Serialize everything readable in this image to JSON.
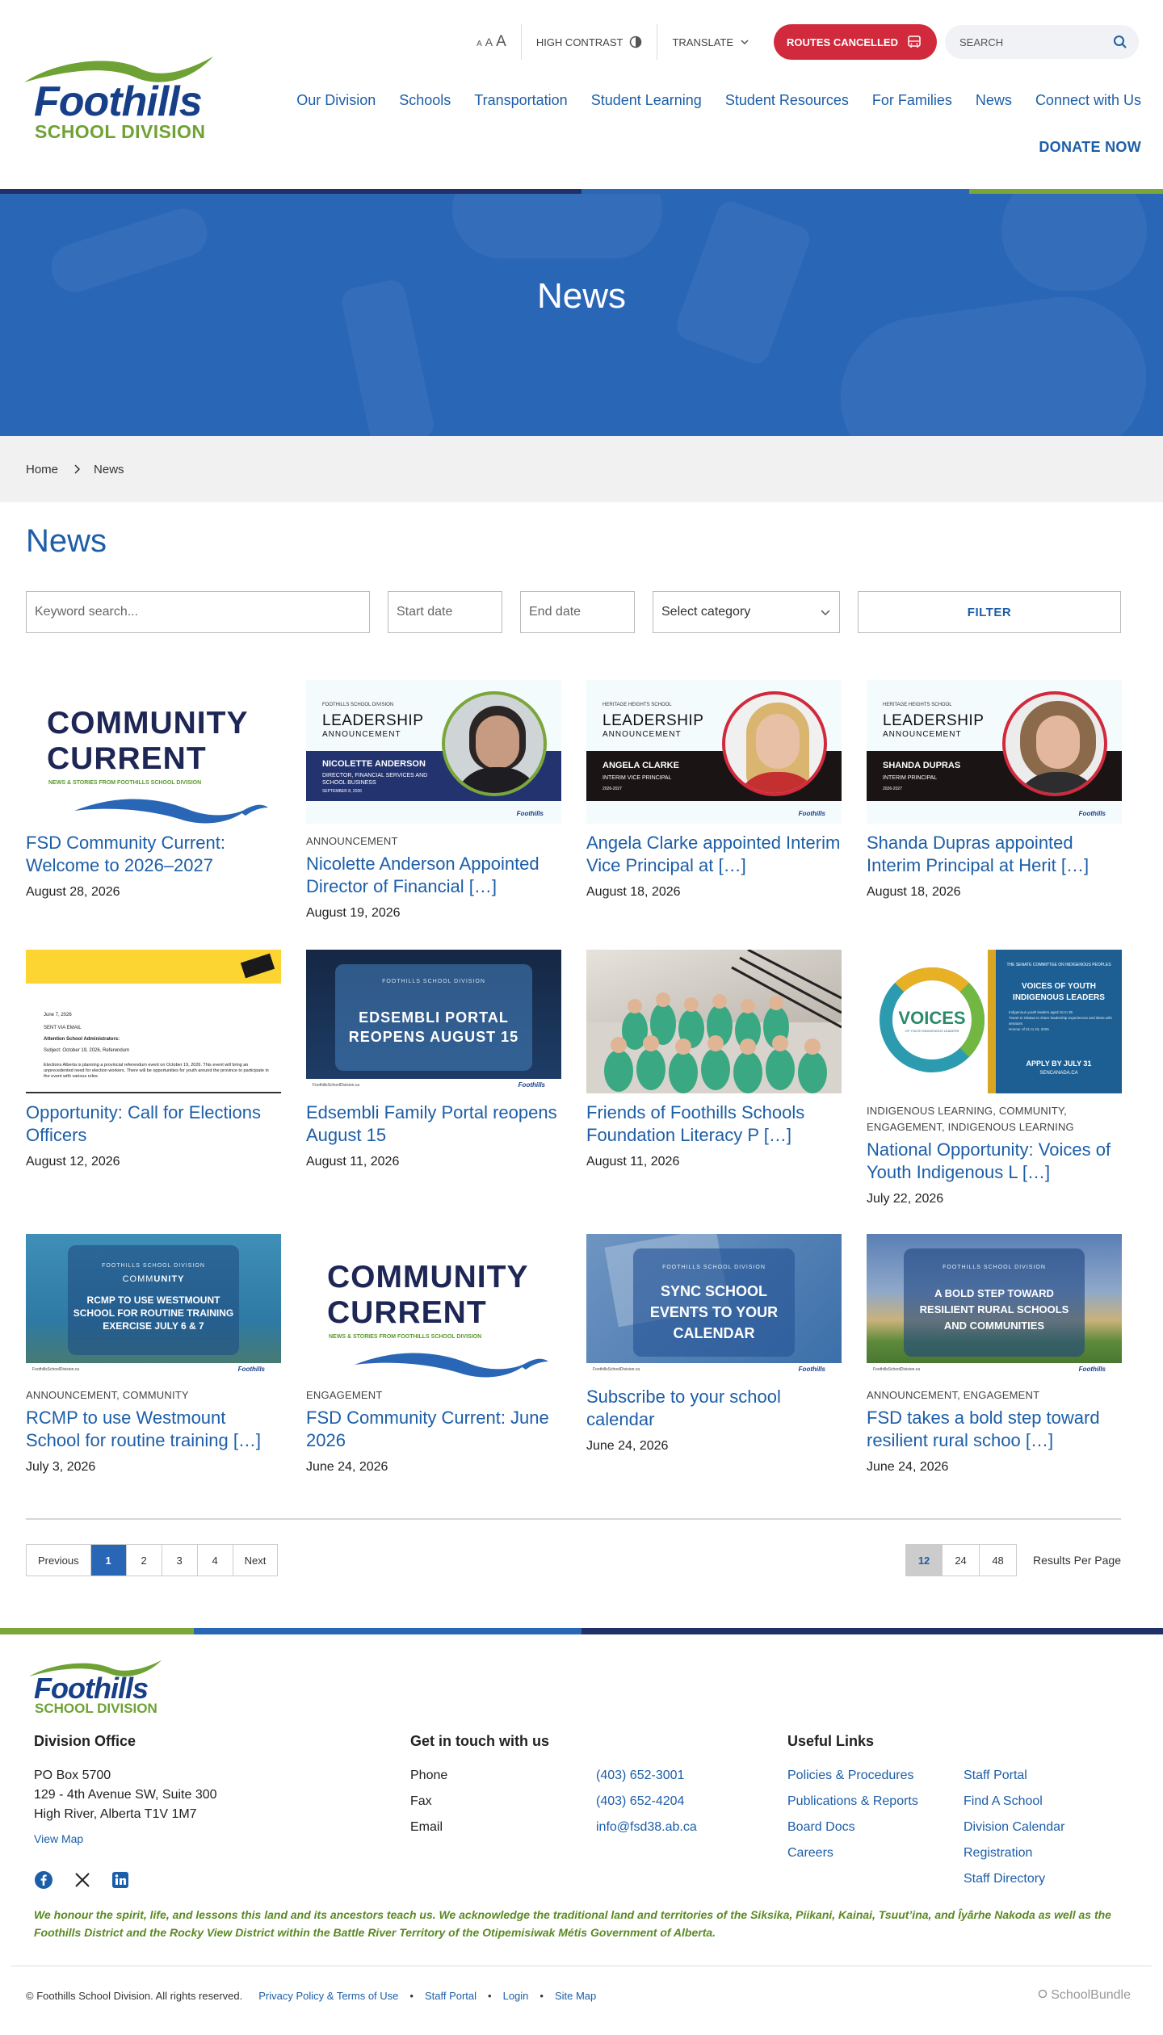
{
  "header": {
    "logo": {
      "line1": "Foothills",
      "line2": "SCHOOL DIVISION"
    },
    "text_size": [
      "A",
      "A",
      "A"
    ],
    "high_contrast": "HIGH CONTRAST",
    "translate": "TRANSLATE",
    "routes": "ROUTES CANCELLED",
    "search_placeholder": "SEARCH",
    "nav": [
      "Our Division",
      "Schools",
      "Transportation",
      "Student Learning",
      "Student Resources",
      "For Families",
      "News",
      "Connect with Us"
    ],
    "donate": "DONATE NOW"
  },
  "colors": {
    "brand_blue": "#1c5ea8",
    "hero_blue": "#2a66b6",
    "navy": "#22306a",
    "green": "#7aa63a",
    "alert_red": "#d12a3c"
  },
  "hero": {
    "title": "News"
  },
  "breadcrumb": {
    "home": "Home",
    "current": "News"
  },
  "page": {
    "title": "News"
  },
  "filters": {
    "keyword_placeholder": "Keyword search...",
    "start_placeholder": "Start date",
    "end_placeholder": "End date",
    "category": "Select category",
    "button": "FILTER"
  },
  "thumb_text": {
    "community_current": {
      "line1": "COMMUNITY",
      "line2": "CURRENT",
      "tag": "NEWS & STORIES FROM FOOTHILLS SCHOOL DIVISION"
    },
    "leadership_nicolette": {
      "school": "FOOTHILLS SCHOOL DIVISION",
      "head1": "LEADERSHIP",
      "head2": "ANNOUNCEMENT",
      "name": "NICOLETTE ANDERSON",
      "role": "DIRECTOR, FINANCIAL SERVICES AND SCHOOL BUSINESS",
      "date": "SEPTEMBER 8, 2026"
    },
    "leadership_angela": {
      "school": "HERITAGE HEIGHTS SCHOOL",
      "head1": "LEADERSHIP",
      "head2": "ANNOUNCEMENT",
      "name": "ANGELA CLARKE",
      "role": "INTERIM VICE PRINCIPAL",
      "term": "2026-2027"
    },
    "leadership_shanda": {
      "school": "HERITAGE HEIGHTS SCHOOL",
      "head1": "LEADERSHIP",
      "head2": "ANNOUNCEMENT",
      "name": "SHANDA DUPRAS",
      "role": "INTERIM PRINCIPAL",
      "term": "2026-2027"
    },
    "elections_letter": {
      "date": "June 7, 2026",
      "sent": "SENT VIA EMAIL",
      "to": "Attention School Administrators:",
      "subject": "Subject: October 19, 2026, Referendum",
      "body": "Elections Alberta is planning a provincial referendum event on October 19, 2026. This event will bring an unprecedented need for election workers. There will be opportunities for youth around the province to participate in the event with various roles."
    },
    "edsembli": {
      "org": "FOOTHILLS SCHOOL DIVISION",
      "line1": "EDSEMBLI PORTAL",
      "line2": "REOPENS AUGUST 15"
    },
    "voices": {
      "ring": "VOICES",
      "sub": "OF YOUTH INDIGENOUS LEADERS",
      "org": "THE SENATE COMMITTEE ON INDIGENOUS PEOPLES",
      "h1": "VOICES OF YOUTH",
      "h2": "INDIGENOUS LEADERS",
      "b1": "Indigenous youth leaders aged 16 to 35",
      "b2": "Travel to Ottawa to share leadership experiences and ideas with senators",
      "b3": "Honour of 21 to 23, 2026",
      "apply": "APPLY BY JULY 31",
      "site": "SENCANADA.CA"
    },
    "rcmp": {
      "org": "FOOTHILLS SCHOOL DIVISION",
      "word1": "COMM",
      "word2": "UNITY",
      "line1": "RCMP TO USE WESTMOUNT",
      "line2": "SCHOOL FOR ROUTINE TRAINING",
      "line3": "EXERCISE JULY 6 & 7"
    },
    "sync": {
      "org": "FOOTHILLS SCHOOL DIVISION",
      "line1": "SYNC SCHOOL",
      "line2": "EVENTS TO YOUR",
      "line3": "CALENDAR"
    },
    "bold_step": {
      "org": "FOOTHILLS SCHOOL DIVISION",
      "line1": "A BOLD STEP TOWARD",
      "line2": "RESILIENT RURAL SCHOOLS",
      "line3": "AND COMMUNITIES"
    },
    "site_url": "FoothillsSchoolDivision.ca",
    "fsd": "Foothills"
  },
  "articles": [
    {
      "cats": "",
      "title": "FSD Community Current: Welcome to 2026–2027",
      "date": "August 28, 2026"
    },
    {
      "cats": "ANNOUNCEMENT",
      "title": "Nicolette Anderson Appointed Director of Financial […]",
      "date": "August 19, 2026"
    },
    {
      "cats": "",
      "title": "Angela Clarke appointed Interim Vice Principal at […]",
      "date": "August 18, 2026"
    },
    {
      "cats": "",
      "title": "Shanda Dupras appointed Interim Principal at Herit […]",
      "date": "August 18, 2026"
    },
    {
      "cats": "",
      "title": "Opportunity: Call for Elections Officers",
      "date": "August 12, 2026"
    },
    {
      "cats": "",
      "title": "Edsembli Family Portal reopens August 15",
      "date": "August 11, 2026"
    },
    {
      "cats": "",
      "title": "Friends of Foothills Schools Foundation Literacy P […]",
      "date": "August 11, 2026"
    },
    {
      "cats": "INDIGENOUS LEARNING, COMMUNITY, ENGAGEMENT, INDIGENOUS LEARNING",
      "title": "National Opportunity: Voices of Youth Indigenous L […]",
      "date": "July 22, 2026"
    },
    {
      "cats": "ANNOUNCEMENT, COMMUNITY",
      "title": "RCMP to use Westmount School for routine training […]",
      "date": "July 3, 2026"
    },
    {
      "cats": "ENGAGEMENT",
      "title": "FSD Community Current: June 2026",
      "date": "June 24, 2026"
    },
    {
      "cats": "",
      "title": "Subscribe to your school calendar",
      "date": "June 24, 2026"
    },
    {
      "cats": "ANNOUNCEMENT, ENGAGEMENT",
      "title": "FSD takes a bold step toward resilient rural schoo […]",
      "date": "June 24, 2026"
    }
  ],
  "pagination": {
    "prev": "Previous",
    "pages": [
      "1",
      "2",
      "3",
      "4"
    ],
    "next": "Next",
    "current": "1"
  },
  "per_page": {
    "options": [
      "12",
      "24",
      "48"
    ],
    "selected": "12",
    "label": "Results Per Page"
  },
  "footer": {
    "logo": {
      "line1": "Foothills",
      "line2": "SCHOOL DIVISION"
    },
    "office": {
      "heading": "Division Office",
      "line1": "PO Box 5700",
      "line2": "129 - 4th Avenue SW, Suite 300",
      "line3": "High River, Alberta T1V 1M7",
      "map": "View Map"
    },
    "contact": {
      "heading": "Get in touch with us",
      "rows": [
        {
          "label": "Phone",
          "value": "(403) 652-3001"
        },
        {
          "label": "Fax",
          "value": "(403) 652-4204"
        },
        {
          "label": "Email",
          "value": "info@fsd38.ab.ca"
        }
      ]
    },
    "links": {
      "heading": "Useful Links",
      "items": [
        "Policies & Procedures",
        "Staff Portal",
        "Publications & Reports",
        "Find A School",
        "Board Docs",
        "Division Calendar",
        "Careers",
        "Registration",
        "",
        "Staff Directory"
      ]
    },
    "social": [
      "facebook-icon",
      "x-icon",
      "linkedin-icon"
    ],
    "ack": "We honour the spirit, life, and lessons this land and its ancestors teach us. We acknowledge the traditional land and territories of the Siksika, Piikani, Kainai, Tsuut’ina, and Îyârhe Nakoda as well as the Foothills District and the Rocky View District within the Battle River Territory of the Otipemisiwak Métis Government of Alberta.",
    "copyright": "© Foothills School Division. All rights reserved.",
    "bottom_links": [
      "Privacy Policy & Terms of Use",
      "Staff Portal",
      "Login",
      "Site Map"
    ],
    "sep": "•",
    "credit": "SchoolBundle"
  }
}
